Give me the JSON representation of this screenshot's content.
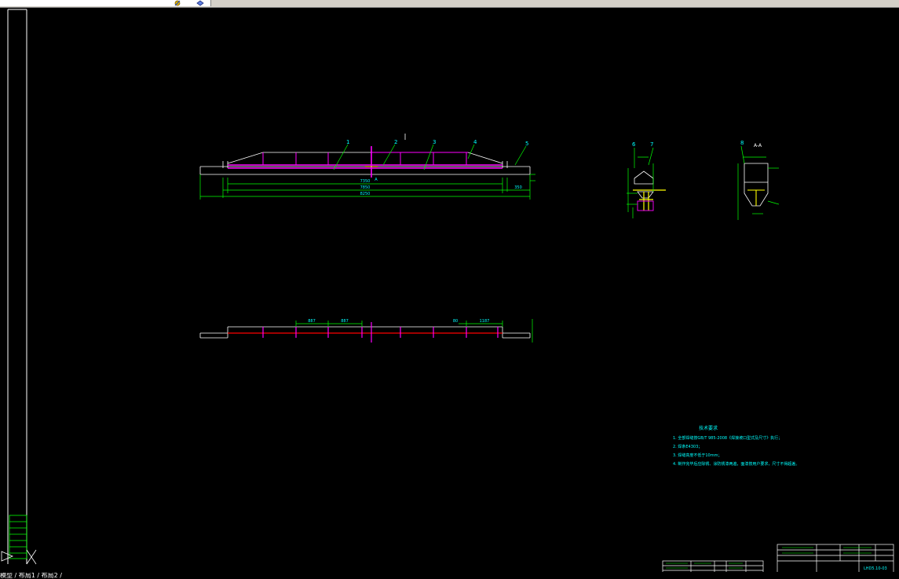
{
  "app": {
    "toolbar_icons": [
      "layer-tool-icon",
      "layer-property-icon"
    ],
    "layout_tabs": "模型 / 布局1 / 布局2 /"
  },
  "drawing": {
    "background": "#000000",
    "colors": {
      "frame": "#ffffff",
      "dimension": "#00ff00",
      "beam": "#ff00ff",
      "text": "#00ffff",
      "accent": "#ffff00",
      "center": "#ff0000"
    },
    "elevation": {
      "callouts": [
        "1",
        "2",
        "3",
        "4",
        "5"
      ],
      "dims": [
        "7350",
        "7850",
        "8250",
        "350"
      ],
      "marker": "A"
    },
    "plan": {
      "dims": [
        "887",
        "887",
        "80",
        "1187"
      ]
    },
    "section_a": {
      "callouts": [
        "6",
        "7"
      ]
    },
    "section_b": {
      "callouts": [
        "8"
      ],
      "label": "A-A"
    },
    "notes": {
      "heading": "技术要求",
      "items": [
        "1. 全部焊缝按GB/T 985-2008《焊接坡口型式及尺寸》执行；",
        "2. 焊条E4303；",
        "3. 焊缝高度不低于10mm；",
        "4. 制作完毕后应除锈、涂防锈漆两遍，面漆按用户要求，尺寸不得超差。"
      ]
    },
    "title_block": {
      "drawing_no": "LHD5.10-03"
    }
  }
}
